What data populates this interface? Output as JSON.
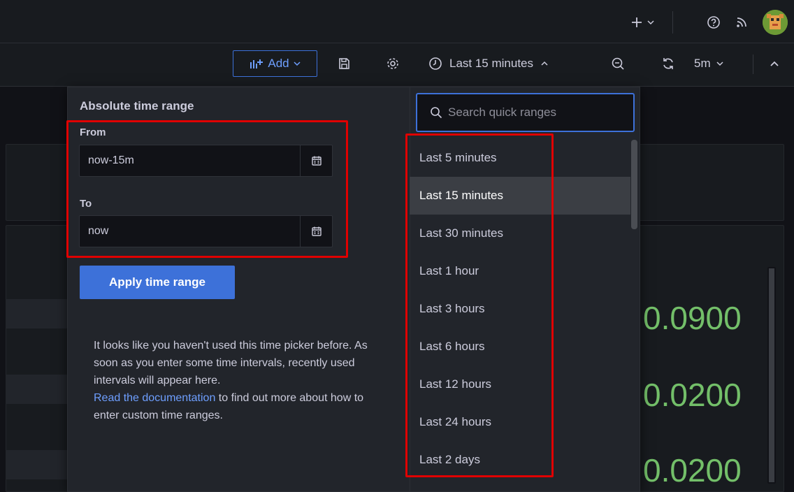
{
  "top_bar": {
    "new_icon": "plus-icon",
    "help_icon": "question-circle-icon",
    "news_icon": "rss-icon",
    "avatar": "user-avatar"
  },
  "toolbar": {
    "add_label": "Add",
    "time_range_label": "Last 15 minutes",
    "refresh_interval": "5m"
  },
  "stats": [
    "0.0900",
    "0.0200",
    "0.0200"
  ],
  "picker": {
    "title": "Absolute time range",
    "from_label": "From",
    "from_value": "now-15m",
    "to_label": "To",
    "to_value": "now",
    "apply_label": "Apply time range",
    "help_text": "It looks like you haven't used this time picker before. As soon as you enter some time intervals, recently used intervals will appear here.",
    "doc_link": "Read the documentation",
    "doc_suffix": " to find out more about how to enter custom time ranges.",
    "search_placeholder": "Search quick ranges",
    "quick_ranges": [
      "Last 5 minutes",
      "Last 15 minutes",
      "Last 30 minutes",
      "Last 1 hour",
      "Last 3 hours",
      "Last 6 hours",
      "Last 12 hours",
      "Last 24 hours",
      "Last 2 days"
    ],
    "selected_range": "Last 15 minutes"
  },
  "colors": {
    "accent": "#3d71d9",
    "stat_green": "#73bf69",
    "highlight": "#e00000"
  }
}
